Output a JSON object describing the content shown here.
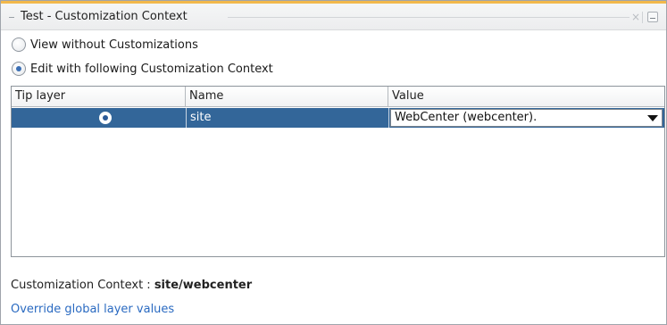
{
  "window": {
    "title": "Test - Customization Context",
    "close_glyph": "×",
    "accent_color": "#f2b84b"
  },
  "options": {
    "view_without": {
      "label": "View without Customizations",
      "checked": false
    },
    "edit_with": {
      "label": "Edit with following Customization Context",
      "checked": true
    }
  },
  "table": {
    "columns": [
      "Tip layer",
      "Name",
      "Value"
    ],
    "rows": [
      {
        "tip_layer_selected": true,
        "name": "site",
        "value": "WebCenter (webcenter)."
      }
    ],
    "selection_color": "#336699"
  },
  "footer": {
    "context_label": "Customization Context : ",
    "context_value": "site/webcenter",
    "override_link": "Override global layer values",
    "link_color": "#2a6ac1"
  },
  "icons": {
    "close": "close-icon",
    "minimize": "minimize-icon",
    "dropdown": "chevron-down-icon"
  }
}
